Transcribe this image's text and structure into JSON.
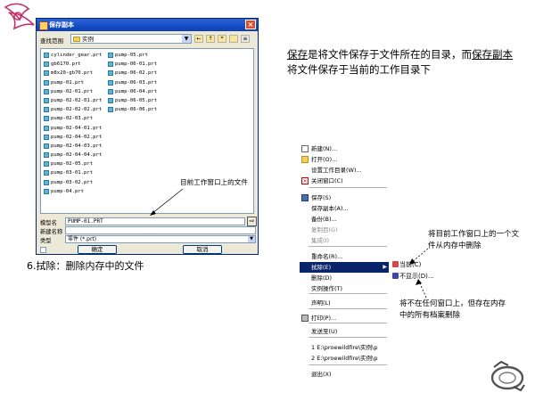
{
  "dialog": {
    "title": "保存副本",
    "close_glyph": "×",
    "look_in_label": "查找范围",
    "look_in_value": "实例",
    "files_col1": [
      "cylinder_gear.prt",
      "gb6170.prt",
      "m8x20-gb70.prt",
      "pump-01.prt",
      "pump-02-01.prt",
      "pump-02-02-01.prt",
      "pump-02-02-02.prt",
      "pump-02-03.prt",
      "pump-02-04-01.prt",
      "pump-02-04-02.prt",
      "pump-02-04-03.prt",
      "pump-02-04-04.prt",
      "pump-02-05.prt",
      "pump-03-01.prt",
      "pump-03-02.prt",
      "pump-04.prt"
    ],
    "files_col2": [
      "pump-05.prt",
      "pump-06-01.prt",
      "pump-06-02.prt",
      "pump-06-03.prt",
      "pump-06-04.prt",
      "pump-06-05.prt",
      "pump-06-06.prt"
    ],
    "model_name_label": "模型名",
    "model_name_value": "PUMP-01.PRT",
    "new_name_label": "新建名称",
    "new_name_value": "",
    "type_label": "类型",
    "type_value": "零件 (*.prt)",
    "ok_label": "确定",
    "cancel_label": "取消"
  },
  "annotation_window": "目前工作窗口上的文件",
  "caption_erase": "6.拭除：删除内存中的文件",
  "paragraph": {
    "save_word": "保存",
    "text_1": "是将文件保存于文件所在的目录，而",
    "save_copy_word": "保存副本",
    "text_2": "将文件保存于当前的工作目录下"
  },
  "menu": {
    "items": [
      {
        "label": "新建(N)...",
        "icon": "new-file-icon"
      },
      {
        "label": "打开(O)...",
        "icon": "open-folder-icon"
      },
      {
        "label": "设置工作目录(W)...",
        "icon": ""
      },
      {
        "label": "关闭窗口(C)",
        "icon": "close-window-icon"
      },
      {
        "label": "保存(S)",
        "icon": "save-disk-icon"
      },
      {
        "label": "保存副本(A)...",
        "icon": ""
      },
      {
        "label": "备份(B)...",
        "icon": ""
      },
      {
        "label": "复制目(G)",
        "icon": ""
      },
      {
        "label": "集成(I)",
        "icon": ""
      },
      {
        "label": "重命名(R)...",
        "icon": ""
      },
      {
        "label": "拭除(E)",
        "icon": ""
      },
      {
        "label": "删除(D)",
        "icon": ""
      },
      {
        "label": "实例操作(T)",
        "icon": ""
      },
      {
        "label": "声明(L)",
        "icon": ""
      },
      {
        "label": "打印(P)...",
        "icon": "printer-icon"
      },
      {
        "label": "发送至(U)",
        "icon": ""
      },
      {
        "label": "1 E:\\proewildfire\\实例\\p",
        "icon": ""
      },
      {
        "label": "2 E:\\proewildfire\\实例\\p",
        "icon": ""
      },
      {
        "label": "退出(X)",
        "icon": ""
      }
    ],
    "submenu_current": "当前(C)",
    "submenu_not_displayed": "不显示(D)..."
  },
  "annotation_current": "将目前工作窗口上的一个文件从内存中删除",
  "annotation_not_displayed": "将不在任何窗口上，但存在内存中的所有档案删除"
}
